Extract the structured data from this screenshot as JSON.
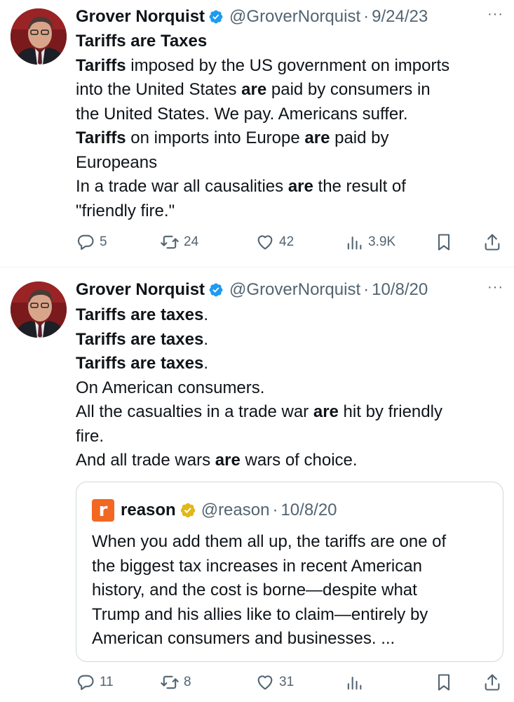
{
  "tweets": [
    {
      "author": "Grover Norquist",
      "handle": "@GroverNorquist",
      "separator": "·",
      "date": "9/24/23",
      "more": "···",
      "lines": [
        [
          {
            "t": "Tariffs are Taxes",
            "b": true
          }
        ],
        [
          {
            "t": "Tariffs",
            "b": true
          },
          {
            "t": " imposed by the US government on imports",
            "b": false
          }
        ],
        [
          {
            "t": "into the United States ",
            "b": false
          },
          {
            "t": "are",
            "b": true
          },
          {
            "t": " paid by consumers in",
            "b": false
          }
        ],
        [
          {
            "t": "the United States.  We pay. Americans suffer.",
            "b": false
          }
        ],
        [
          {
            "t": "Tariffs",
            "b": true
          },
          {
            "t": " on imports into Europe ",
            "b": false
          },
          {
            "t": "are",
            "b": true
          },
          {
            "t": " paid by",
            "b": false
          }
        ],
        [
          {
            "t": "Europeans",
            "b": false
          }
        ],
        [
          {
            "t": "In a trade war all causalities ",
            "b": false
          },
          {
            "t": "are",
            "b": true
          },
          {
            "t": " the result of",
            "b": false
          }
        ],
        [
          {
            "t": "\"friendly fire.\"",
            "b": false
          }
        ]
      ],
      "actions": {
        "replies": "5",
        "reposts": "24",
        "likes": "42",
        "views": "3.9K"
      }
    },
    {
      "author": "Grover Norquist",
      "handle": "@GroverNorquist",
      "separator": "·",
      "date": "10/8/20",
      "more": "···",
      "lines": [
        [
          {
            "t": "Tariffs are taxes",
            "b": true
          },
          {
            "t": ".",
            "b": false
          }
        ],
        [
          {
            "t": "Tariffs are taxes",
            "b": true
          },
          {
            "t": ".",
            "b": false
          }
        ],
        [
          {
            "t": "Tariffs are taxes",
            "b": true
          },
          {
            "t": ".",
            "b": false
          }
        ],
        [
          {
            "t": "On American consumers.",
            "b": false
          }
        ],
        [
          {
            "t": "All the casualties in a trade war ",
            "b": false
          },
          {
            "t": "are",
            "b": true
          },
          {
            "t": " hit by friendly",
            "b": false
          }
        ],
        [
          {
            "t": "fire.",
            "b": false
          }
        ],
        [
          {
            "t": "And all trade wars ",
            "b": false
          },
          {
            "t": "are",
            "b": true
          },
          {
            "t": " wars of choice.",
            "b": false
          }
        ]
      ],
      "quote": {
        "logo_letter": "r",
        "author": "reason",
        "handle": "@reason",
        "separator": "·",
        "date": "10/8/20",
        "lines": [
          "When you add them all up, the tariffs are one of",
          "the biggest tax increases in recent American",
          "history, and the cost is borne—despite what",
          "Trump and his allies like to claim—entirely by",
          "American consumers and businesses. ..."
        ],
        "logo_color": "#f26722",
        "badge_color": "#e2b719"
      },
      "actions": {
        "replies": "11",
        "reposts": "8",
        "likes": "31",
        "views": ""
      }
    }
  ],
  "colors": {
    "verified_blue": "#1d9bf0",
    "muted": "#536471",
    "text": "#0f1419"
  },
  "icons": [
    "verified-badge-icon",
    "reply-icon",
    "repost-icon",
    "like-icon",
    "views-icon",
    "bookmark-icon",
    "share-icon",
    "more-icon"
  ]
}
